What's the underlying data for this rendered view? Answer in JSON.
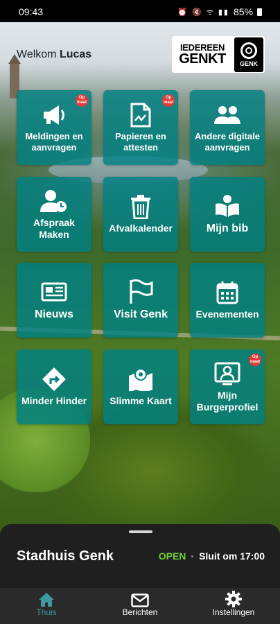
{
  "status_bar": {
    "time": "09:43",
    "battery": "85%"
  },
  "header": {
    "welcome_prefix": "Welkom",
    "user_name": "Lucas",
    "logo_line1": "IEDEREEN",
    "logo_line2": "GENKT",
    "seal_text": "GENK"
  },
  "badge": {
    "line1": "Op",
    "line2": "maat"
  },
  "tiles": [
    {
      "label": "Meldingen en\naanvragen",
      "icon": "megaphone-icon",
      "badge": true
    },
    {
      "label": "Papieren en\nattesten",
      "icon": "document-icon",
      "badge": true
    },
    {
      "label": "Andere digitale\naanvragen",
      "icon": "people-icon",
      "badge": false
    },
    {
      "label": "Afspraak\nMaken",
      "icon": "user-clock-icon",
      "badge": false
    },
    {
      "label": "Afvalkalender",
      "icon": "trash-icon",
      "badge": false
    },
    {
      "label": "Mijn bib",
      "icon": "book-reader-icon",
      "badge": false
    },
    {
      "label": "Nieuws",
      "icon": "newspaper-icon",
      "badge": false
    },
    {
      "label": "Visit Genk",
      "icon": "flag-icon",
      "badge": false
    },
    {
      "label": "Evenementen",
      "icon": "calendar-icon",
      "badge": false
    },
    {
      "label": "Minder Hinder",
      "icon": "directions-icon",
      "badge": false
    },
    {
      "label": "Slimme Kaart",
      "icon": "map-icon",
      "badge": false
    },
    {
      "label": "Mijn\nBurgerprofiel",
      "icon": "profile-card-icon",
      "badge": true
    }
  ],
  "bottom_sheet": {
    "title": "Stadhuis Genk",
    "open_label": "OPEN",
    "separator": "·",
    "closing": "Sluit om 17:00"
  },
  "nav": {
    "home": "Thuis",
    "messages": "Berichten",
    "settings": "Instellingen"
  },
  "colors": {
    "tile": "#008082",
    "open": "#6fcf3a",
    "nav_active": "#3a9aa0",
    "badge": "#e53935"
  }
}
